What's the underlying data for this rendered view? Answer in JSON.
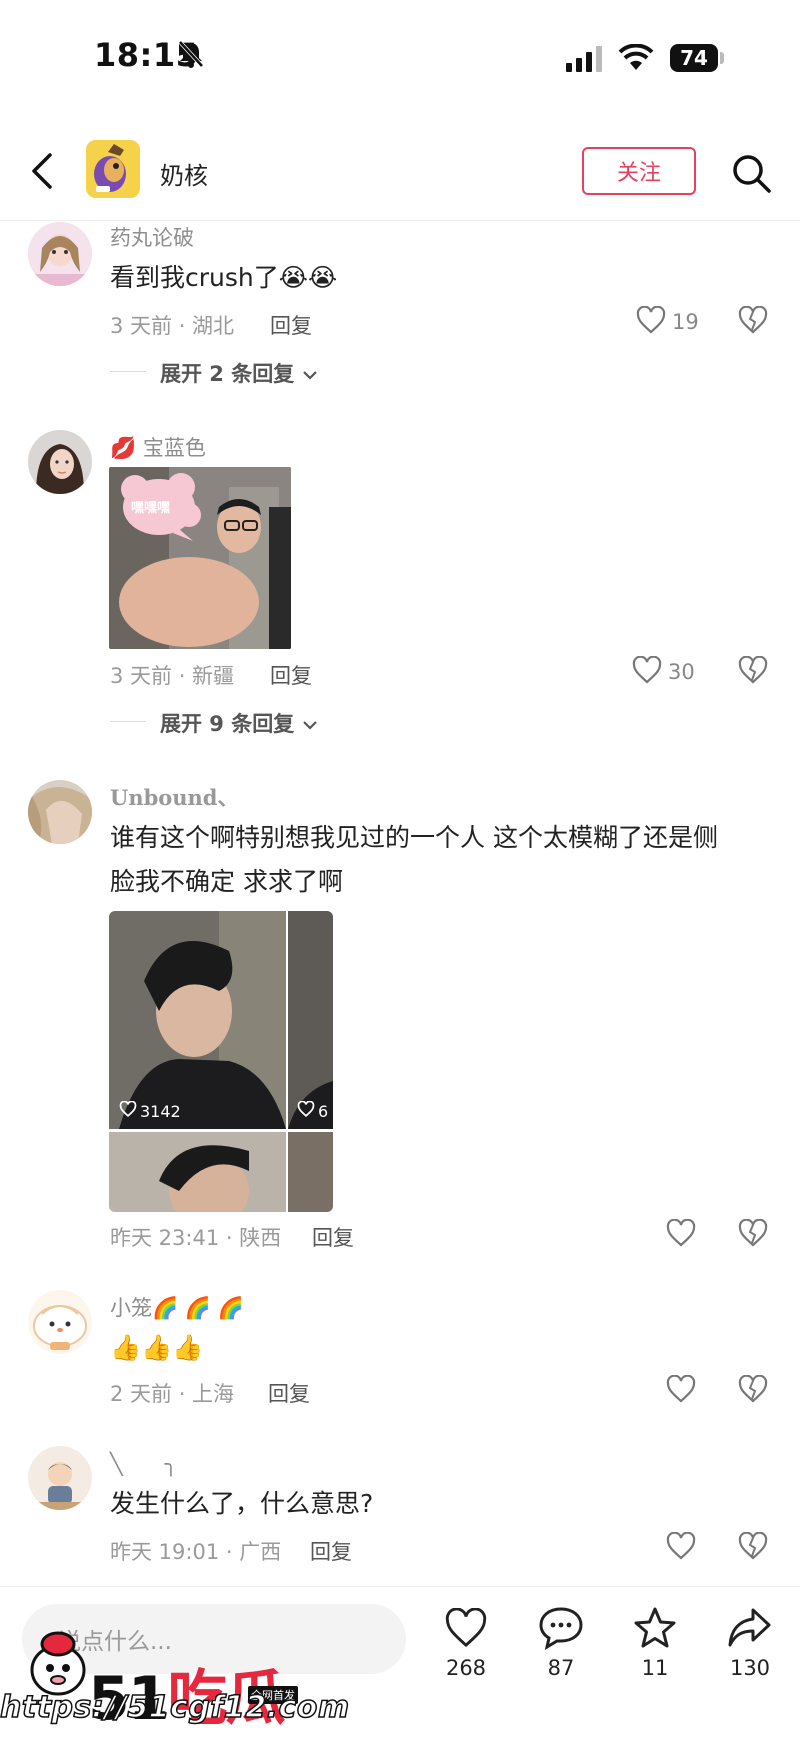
{
  "status_bar": {
    "time": "18:15",
    "battery": "74"
  },
  "header": {
    "title": "奶核",
    "follow_label": "关注"
  },
  "comments": [
    {
      "username": "药丸论破",
      "text": "看到我crush了😭😭",
      "meta": "3 天前 · 湖北",
      "reply_label": "回复",
      "likes": "19",
      "expand_label": "展开 2 条回复"
    },
    {
      "username": "💋 宝蓝色",
      "sticker_text": "嘿嘿嘿",
      "meta": "3 天前 · 新疆",
      "reply_label": "回复",
      "likes": "30",
      "expand_label": "展开 9 条回复"
    },
    {
      "username": "Unbound、",
      "text_line1": "谁有这个啊特别想我见过的一个人 这个太模糊了还是侧",
      "text_line2": "脸我不确定 求求了啊",
      "image_likes": "3142",
      "image_likes_2": "6",
      "meta": "昨天 23:41 · 陕西",
      "reply_label": "回复"
    },
    {
      "username": "小笼🌈 🌈 🌈",
      "text": "👍👍👍",
      "meta": "2 天前 · 上海",
      "reply_label": "回复"
    },
    {
      "username": "╲　　╮",
      "text": "发生什么了，什么意思?",
      "meta": "昨天 19:01 · 广西",
      "reply_label": "回复"
    }
  ],
  "bottom_bar": {
    "placeholder": "说点什么...",
    "likes": "268",
    "comments": "87",
    "stars": "11",
    "shares": "130"
  },
  "watermark": {
    "logo_num": "51",
    "logo_text": "吃瓜",
    "tag": "全网首发",
    "url": "https://51cgf12.com"
  },
  "colors": {
    "accent": "#e8415f",
    "watermark_red": "#e5283e"
  },
  "icons": [
    "back-icon",
    "search-icon",
    "heart-icon",
    "dislike-icon",
    "comment-icon",
    "star-icon",
    "share-icon"
  ]
}
